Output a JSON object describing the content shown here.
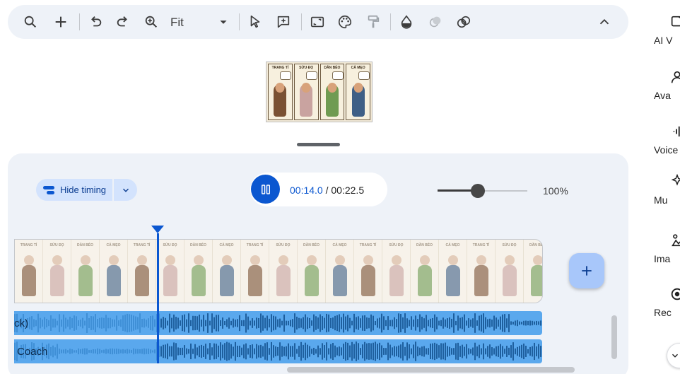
{
  "toolbar": {
    "zoom_mode": "Fit",
    "icons": [
      "search-icon",
      "add-icon",
      "undo-icon",
      "redo-icon",
      "zoom-in-icon",
      "dropdown-icon",
      "select-cursor-icon",
      "comment-add-icon",
      "crop-icon",
      "palette-icon",
      "paint-format-icon",
      "opacity-icon",
      "blend-icon",
      "effects-icon",
      "collapse-icon"
    ]
  },
  "preview": {
    "panels": [
      {
        "title": "TRANG TÍ",
        "color": "#7a5133"
      },
      {
        "title": "SỬU ĐỌ",
        "color": "#c9a3a0"
      },
      {
        "title": "DẦN BÉO",
        "color": "#6f9b52"
      },
      {
        "title": "CẢ MẸO",
        "color": "#3e5f86"
      }
    ]
  },
  "timeline": {
    "hide_timing_label": "Hide timing",
    "current_time": "00:14.0",
    "time_separator": " / ",
    "total_time": "00:22.5",
    "zoom_percent": "100%",
    "zoom_value": 0.45,
    "playhead_fraction": 0.623,
    "frame_titles": [
      "TRANG TÍ",
      "SỬU ĐỌ",
      "DẦN BÉO",
      "CẢ MẸO",
      "TRANG TÍ",
      "SỬU ĐỌ",
      "DẦN BÉO",
      "CẢ MẸO",
      "TRANG TÍ",
      "SỬU ĐỌ",
      "DẦN BÉO",
      "CẢ MẸO",
      "TRANG TÍ",
      "SỬU ĐỌ",
      "DẦN BÉO",
      "CẢ MẸO",
      "TRANG TÍ",
      "SỬU ĐỌ",
      "DẦN BÉO"
    ],
    "audio_tracks": [
      {
        "label": "ck)"
      },
      {
        "label": "Coach"
      }
    ]
  },
  "sidebar": {
    "items": [
      {
        "label": "AI V",
        "icon": "ai-video-icon"
      },
      {
        "label": "Ava",
        "icon": "avatar-icon"
      },
      {
        "label": "Voice",
        "icon": "voice-icon"
      },
      {
        "label": "Mu",
        "icon": "music-icon"
      },
      {
        "label": "Ima",
        "icon": "image-icon"
      },
      {
        "label": "Rec",
        "icon": "record-icon"
      }
    ]
  },
  "colors": {
    "accent": "#0b57d0",
    "audio_track": "#5aa8ed",
    "panel_bg": "#eef2f8"
  }
}
